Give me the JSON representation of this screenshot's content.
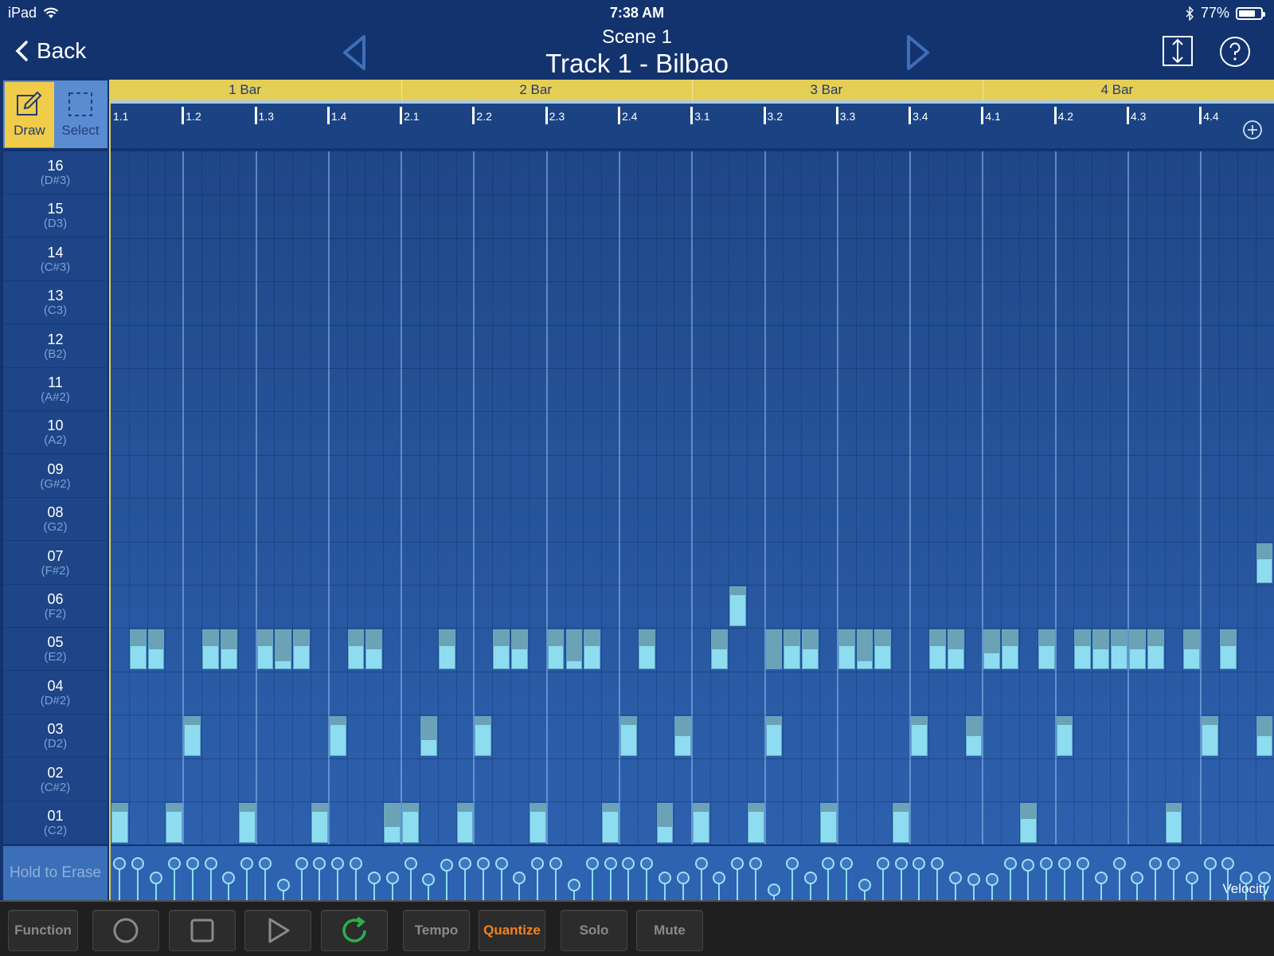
{
  "status": {
    "device": "iPad",
    "time": "7:38 AM",
    "battery": "77%",
    "battery_level": 0.77
  },
  "nav": {
    "back_label": "Back",
    "scene": "Scene  1",
    "track": "Track 1 - Bilbao"
  },
  "tools": {
    "draw": "Draw",
    "select": "Select"
  },
  "bars": [
    "1 Bar",
    "2 Bar",
    "3 Bar",
    "4 Bar"
  ],
  "beats": [
    "1.1",
    "1.2",
    "1.3",
    "1.4",
    "2.1",
    "2.2",
    "2.3",
    "2.4",
    "3.1",
    "3.2",
    "3.3",
    "3.4",
    "4.1",
    "4.2",
    "4.3",
    "4.4"
  ],
  "pads": [
    {
      "num": "16",
      "note": "(D#3)"
    },
    {
      "num": "15",
      "note": "(D3)"
    },
    {
      "num": "14",
      "note": "(C#3)"
    },
    {
      "num": "13",
      "note": "(C3)"
    },
    {
      "num": "12",
      "note": "(B2)"
    },
    {
      "num": "11",
      "note": "(A#2)"
    },
    {
      "num": "10",
      "note": "(A2)"
    },
    {
      "num": "09",
      "note": "(G#2)"
    },
    {
      "num": "08",
      "note": "(G2)"
    },
    {
      "num": "07",
      "note": "(F#2)"
    },
    {
      "num": "06",
      "note": "(F2)"
    },
    {
      "num": "05",
      "note": "(E2)"
    },
    {
      "num": "04",
      "note": "(D#2)"
    },
    {
      "num": "03",
      "note": "(D2)"
    },
    {
      "num": "02",
      "note": "(C#2)"
    },
    {
      "num": "01",
      "note": "(C2)"
    }
  ],
  "notes": [
    {
      "pad": "07",
      "start": 63.0,
      "len": 1,
      "vel": 0.6
    },
    {
      "pad": "06",
      "start": 34.0,
      "len": 1,
      "vel": 0.8
    },
    {
      "pad": "05",
      "start": 1,
      "len": 1,
      "vel": 0.6
    },
    {
      "pad": "05",
      "start": 2,
      "len": 1,
      "vel": 0.5
    },
    {
      "pad": "05",
      "start": 5,
      "len": 1,
      "vel": 0.6
    },
    {
      "pad": "05",
      "start": 6,
      "len": 1,
      "vel": 0.5
    },
    {
      "pad": "05",
      "start": 8,
      "len": 1,
      "vel": 0.6
    },
    {
      "pad": "05",
      "start": 9,
      "len": 1,
      "vel": 0.2
    },
    {
      "pad": "05",
      "start": 10,
      "len": 1,
      "vel": 0.6
    },
    {
      "pad": "05",
      "start": 13,
      "len": 1,
      "vel": 0.6
    },
    {
      "pad": "05",
      "start": 14,
      "len": 1,
      "vel": 0.5
    },
    {
      "pad": "05",
      "start": 18,
      "len": 1,
      "vel": 0.6
    },
    {
      "pad": "05",
      "start": 21,
      "len": 1,
      "vel": 0.6
    },
    {
      "pad": "05",
      "start": 22,
      "len": 1,
      "vel": 0.5
    },
    {
      "pad": "05",
      "start": 24,
      "len": 1,
      "vel": 0.6
    },
    {
      "pad": "05",
      "start": 25,
      "len": 1,
      "vel": 0.2
    },
    {
      "pad": "05",
      "start": 26,
      "len": 1,
      "vel": 0.6
    },
    {
      "pad": "05",
      "start": 29,
      "len": 1,
      "vel": 0.6
    },
    {
      "pad": "05",
      "start": 33,
      "len": 1,
      "vel": 0.5
    },
    {
      "pad": "05",
      "start": 36,
      "len": 1,
      "vel": 0.0
    },
    {
      "pad": "05",
      "start": 37,
      "len": 1,
      "vel": 0.6
    },
    {
      "pad": "05",
      "start": 38,
      "len": 1,
      "vel": 0.5
    },
    {
      "pad": "05",
      "start": 40,
      "len": 1,
      "vel": 0.6
    },
    {
      "pad": "05",
      "start": 41,
      "len": 1,
      "vel": 0.2
    },
    {
      "pad": "05",
      "start": 42,
      "len": 1,
      "vel": 0.6
    },
    {
      "pad": "05",
      "start": 45,
      "len": 1,
      "vel": 0.6
    },
    {
      "pad": "05",
      "start": 46,
      "len": 1,
      "vel": 0.5
    },
    {
      "pad": "05",
      "start": 48,
      "len": 1,
      "vel": 0.4
    },
    {
      "pad": "05",
      "start": 49,
      "len": 1,
      "vel": 0.6
    },
    {
      "pad": "05",
      "start": 51,
      "len": 1,
      "vel": 0.6
    },
    {
      "pad": "05",
      "start": 53,
      "len": 1,
      "vel": 0.6
    },
    {
      "pad": "05",
      "start": 54,
      "len": 1,
      "vel": 0.5
    },
    {
      "pad": "05",
      "start": 55,
      "len": 1,
      "vel": 0.6
    },
    {
      "pad": "05",
      "start": 56,
      "len": 1,
      "vel": 0.5
    },
    {
      "pad": "05",
      "start": 57,
      "len": 1,
      "vel": 0.6
    },
    {
      "pad": "05",
      "start": 59,
      "len": 1,
      "vel": 0.5
    },
    {
      "pad": "05",
      "start": 61,
      "len": 1,
      "vel": 0.6
    },
    {
      "pad": "03",
      "start": 4,
      "len": 1,
      "vel": 0.8
    },
    {
      "pad": "03",
      "start": 12,
      "len": 1,
      "vel": 0.8
    },
    {
      "pad": "03",
      "start": 17,
      "len": 1,
      "vel": 0.4
    },
    {
      "pad": "03",
      "start": 20,
      "len": 1,
      "vel": 0.8
    },
    {
      "pad": "03",
      "start": 28,
      "len": 1,
      "vel": 0.8
    },
    {
      "pad": "03",
      "start": 31,
      "len": 1,
      "vel": 0.5
    },
    {
      "pad": "03",
      "start": 36,
      "len": 1,
      "vel": 0.8
    },
    {
      "pad": "03",
      "start": 44,
      "len": 1,
      "vel": 0.8
    },
    {
      "pad": "03",
      "start": 47,
      "len": 1,
      "vel": 0.5
    },
    {
      "pad": "03",
      "start": 52,
      "len": 1,
      "vel": 0.8
    },
    {
      "pad": "03",
      "start": 60,
      "len": 1,
      "vel": 0.8
    },
    {
      "pad": "03",
      "start": 63,
      "len": 1,
      "vel": 0.5
    },
    {
      "pad": "01",
      "start": 0,
      "len": 1,
      "vel": 0.8
    },
    {
      "pad": "01",
      "start": 3,
      "len": 1,
      "vel": 0.8
    },
    {
      "pad": "01",
      "start": 7,
      "len": 1,
      "vel": 0.8
    },
    {
      "pad": "01",
      "start": 11,
      "len": 1,
      "vel": 0.8
    },
    {
      "pad": "01",
      "start": 15,
      "len": 1,
      "vel": 0.4
    },
    {
      "pad": "01",
      "start": 16,
      "len": 1,
      "vel": 0.8
    },
    {
      "pad": "01",
      "start": 19,
      "len": 1,
      "vel": 0.8
    },
    {
      "pad": "01",
      "start": 23,
      "len": 1,
      "vel": 0.8
    },
    {
      "pad": "01",
      "start": 27,
      "len": 1,
      "vel": 0.8
    },
    {
      "pad": "01",
      "start": 30,
      "len": 1,
      "vel": 0.4
    },
    {
      "pad": "01",
      "start": 32,
      "len": 1,
      "vel": 0.8
    },
    {
      "pad": "01",
      "start": 35,
      "len": 1,
      "vel": 0.8
    },
    {
      "pad": "01",
      "start": 39,
      "len": 1,
      "vel": 0.8
    },
    {
      "pad": "01",
      "start": 43,
      "len": 1,
      "vel": 0.8
    },
    {
      "pad": "01",
      "start": 50,
      "len": 1,
      "vel": 0.6
    },
    {
      "pad": "01",
      "start": 58,
      "len": 1,
      "vel": 0.8
    }
  ],
  "velocity_points": [
    0.95,
    0.95,
    0.55,
    0.95,
    0.95,
    0.95,
    0.55,
    0.95,
    0.95,
    0.35,
    0.95,
    0.95,
    0.95,
    0.95,
    0.55,
    0.55,
    0.95,
    0.5,
    0.9,
    0.95,
    0.95,
    0.95,
    0.55,
    0.95,
    0.95,
    0.35,
    0.95,
    0.95,
    0.95,
    0.95,
    0.55,
    0.55,
    0.95,
    0.55,
    0.95,
    0.95,
    0.2,
    0.95,
    0.55,
    0.95,
    0.95,
    0.35,
    0.95,
    0.95,
    0.95,
    0.95,
    0.55,
    0.5,
    0.5,
    0.95,
    0.9,
    0.95,
    0.95,
    0.95,
    0.55,
    0.95,
    0.55,
    0.95,
    0.95,
    0.55,
    0.95,
    0.95,
    0.55,
    0.55
  ],
  "erase_label": "Hold to Erase",
  "velocity_label": "Velocity",
  "toolbar": {
    "function": "Function",
    "tempo": "Tempo",
    "quantize": "Quantize",
    "solo": "Solo",
    "mute": "Mute"
  }
}
